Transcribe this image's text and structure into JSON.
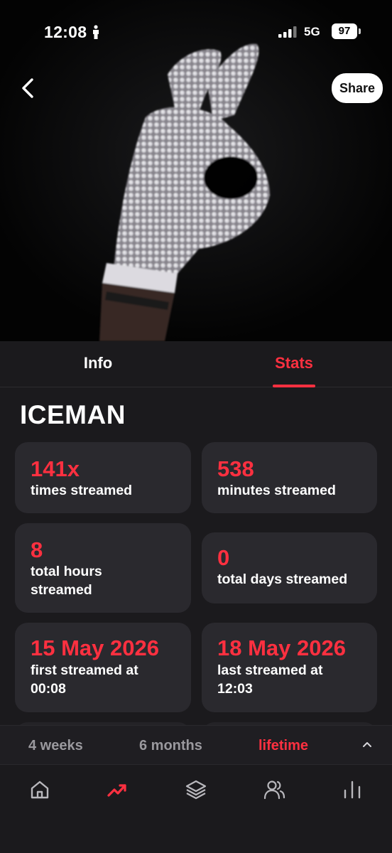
{
  "status_bar": {
    "time": "12:08",
    "network": "5G",
    "battery": "97"
  },
  "header": {
    "share_label": "Share"
  },
  "tabs": [
    {
      "label": "Info",
      "active": false
    },
    {
      "label": "Stats",
      "active": true
    }
  ],
  "track": {
    "title": "ICEMAN"
  },
  "stats": [
    {
      "value": "141x",
      "label": "times streamed"
    },
    {
      "value": "538",
      "label": "minutes streamed"
    },
    {
      "value": "8",
      "label": "total hours streamed"
    },
    {
      "value": "0",
      "label": "total days streamed"
    },
    {
      "value": "15 May 2026",
      "label": "first streamed at 00:08"
    },
    {
      "value": "18 May 2026",
      "label": "last streamed at 12:03"
    }
  ],
  "periods": [
    {
      "label": "4 weeks",
      "active": false
    },
    {
      "label": "6 months",
      "active": false
    },
    {
      "label": "lifetime",
      "active": true
    }
  ],
  "nav": {
    "items": [
      {
        "icon": "home-icon",
        "active": false
      },
      {
        "icon": "trends-icon",
        "active": true
      },
      {
        "icon": "layers-icon",
        "active": false
      },
      {
        "icon": "friends-icon",
        "active": false
      },
      {
        "icon": "bar-chart-icon",
        "active": false
      }
    ]
  },
  "colors": {
    "accent": "#ff3040",
    "background": "#1b1a1d",
    "card": "#2a292e",
    "muted": "#9a999e"
  }
}
